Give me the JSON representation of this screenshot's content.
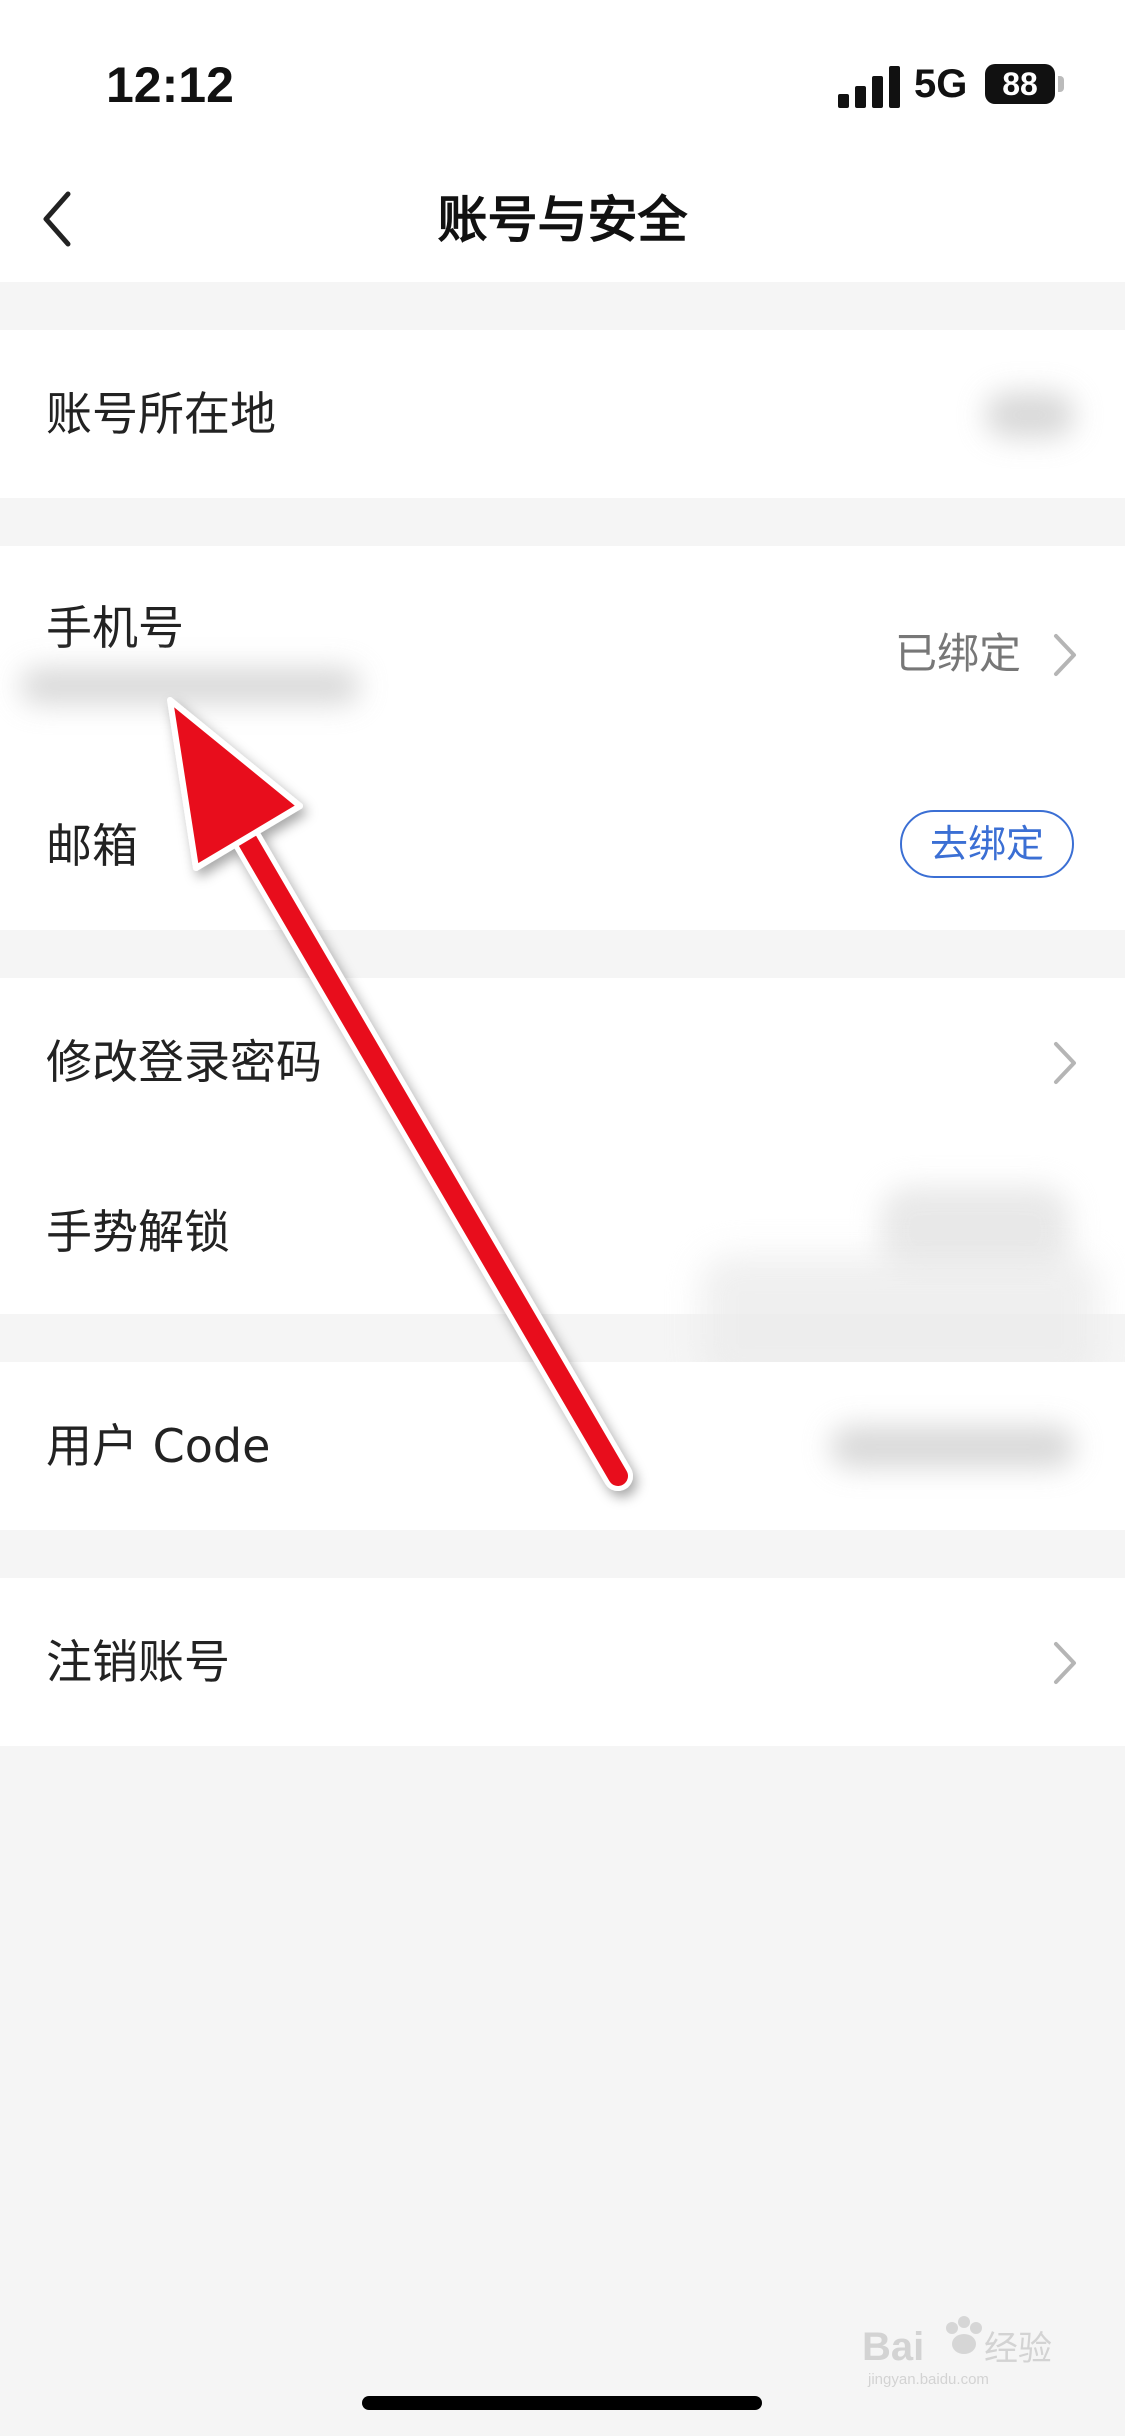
{
  "status_bar": {
    "time": "12:12",
    "network": "5G",
    "battery": "88"
  },
  "header": {
    "title": "账号与安全"
  },
  "rows": {
    "location": {
      "label": "账号所在地"
    },
    "phone": {
      "label": "手机号",
      "status": "已绑定"
    },
    "email": {
      "label": "邮箱",
      "action": "去绑定"
    },
    "password": {
      "label": "修改登录密码"
    },
    "gesture": {
      "label": "手势解锁"
    },
    "user_code": {
      "label": "用户 Code"
    },
    "cancel": {
      "label": "注销账号"
    }
  },
  "watermark": {
    "text": "Bai 经验",
    "sub": "jingyan.baidu.com"
  },
  "colors": {
    "accent": "#3b6fd4",
    "arrow": "#e8101a",
    "background": "#f5f5f5"
  }
}
